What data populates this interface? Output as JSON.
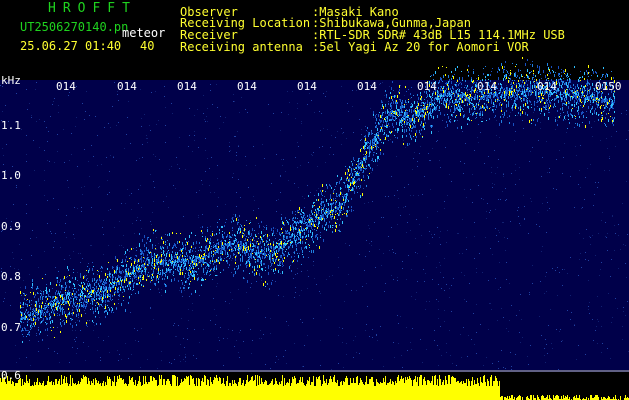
{
  "app": {
    "title": "HROFFT",
    "filename": "UT2506270140.pn",
    "mode": "meteor",
    "datetime": "25.06.27 01:40",
    "count": "40"
  },
  "info": {
    "observer_label": "Observer",
    "observer_value": ":Masaki Kano",
    "location_label": "Receiving Location",
    "location_value": ":Shibukawa,Gunma,Japan",
    "receiver_label": "Receiver",
    "receiver_value": ":RTL-SDR SDR# 43dB L15 114.1MHz USB",
    "antenna_label": "Receiving antenna",
    "antenna_value": ":5el Yagi Az 20 for Aomori VOR"
  },
  "spectrogram": {
    "unit_label": "kHz",
    "y_ticks": [
      "1.1",
      "1.0",
      "0.9",
      "0.8",
      "0.7",
      "0.6"
    ],
    "x_ticks": [
      "014",
      "014",
      "014",
      "014",
      "014",
      "014",
      "014",
      "014",
      "014",
      "0150"
    ],
    "colors": {
      "background": "#00004a",
      "signal": "#ffff00",
      "strong": "#30c0ff",
      "baseline": "#ffff00"
    }
  }
}
